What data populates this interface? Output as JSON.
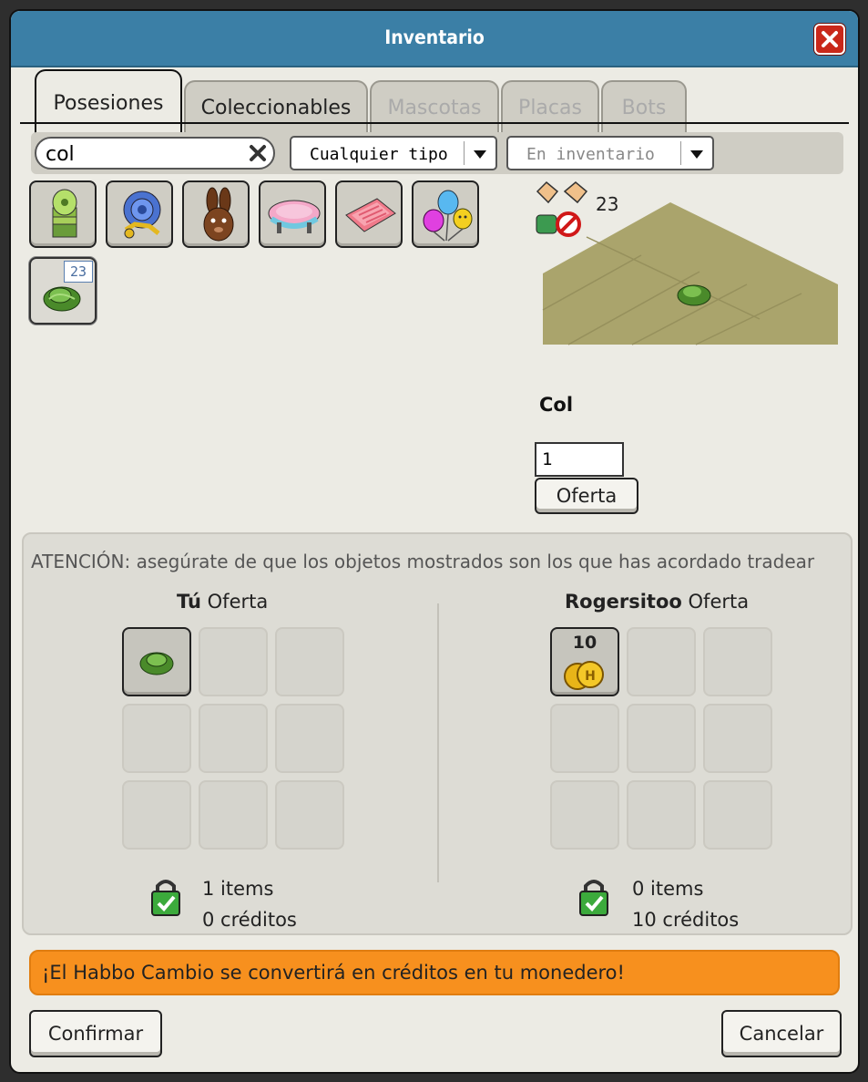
{
  "window": {
    "title": "Inventario"
  },
  "tabs": [
    {
      "label": "Posesiones",
      "state": "active"
    },
    {
      "label": "Coleccionables",
      "state": "normal"
    },
    {
      "label": "Mascotas",
      "state": "disabled"
    },
    {
      "label": "Placas",
      "state": "disabled"
    },
    {
      "label": "Bots",
      "state": "disabled"
    }
  ],
  "filters": {
    "search_value": "col",
    "type_select": "Cualquier tipo",
    "location_select": "En inventario"
  },
  "inventory": {
    "items": [
      {
        "icon": "stacked-lamp-icon"
      },
      {
        "icon": "snail-shell-icon"
      },
      {
        "icon": "chocolate-bunny-icon"
      },
      {
        "icon": "pink-table-icon"
      },
      {
        "icon": "pink-mat-icon"
      },
      {
        "icon": "balloons-icon"
      },
      {
        "icon": "cabbage-icon",
        "count": "23",
        "selected": true
      }
    ]
  },
  "preview": {
    "stack_count": "23",
    "item_name": "Col",
    "quantity": "1",
    "offer_button": "Oferta"
  },
  "trade": {
    "warning": "ATENCIÓN: asegúrate de que los objetos mostrados son los que has acordado tradear",
    "you": {
      "name": "Tú",
      "offer_label": "Oferta",
      "items_text": "1 items",
      "credits_text": "0 créditos",
      "slots": [
        {
          "icon": "cabbage-icon"
        }
      ]
    },
    "other": {
      "name": "Rogersitoo",
      "offer_label": "Oferta",
      "items_text": "0 items",
      "credits_text": "10 créditos",
      "slots": [
        {
          "icon": "gold-coins-icon",
          "label": "10"
        }
      ]
    }
  },
  "notice": "¡El Habbo Cambio se convertirá en créditos en tu monedero!",
  "buttons": {
    "confirm": "Confirmar",
    "cancel": "Cancelar"
  },
  "colors": {
    "titlebar": "#3b7fa6",
    "notice": "#f7901e",
    "close": "#c9281a"
  }
}
